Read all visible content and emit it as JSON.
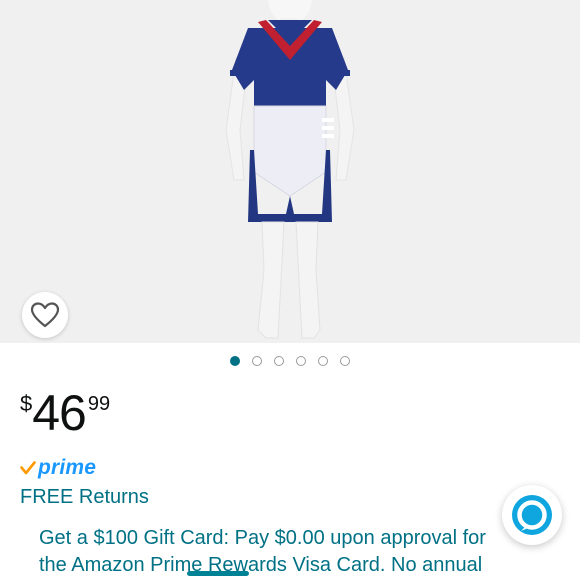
{
  "product": {
    "image_alt": "Child mannequin wearing navy sailor costume with white apron",
    "carousel": {
      "total": 6,
      "active_index": 0
    }
  },
  "price": {
    "symbol": "$",
    "whole": "46",
    "fraction": "99"
  },
  "prime": {
    "check": "✓",
    "label": "prime"
  },
  "returns_label": "FREE Returns",
  "promo_text": "Get a $100 Gift Card: Pay $0.00 upon approval for the Amazon Prime Rewards Visa Card. No annual",
  "icons": {
    "wishlist": "heart-icon",
    "assistant": "alexa-icon"
  },
  "colors": {
    "link": "#007185",
    "prime_blue": "#1a98ff",
    "prime_check": "#ff9900",
    "text": "#0f1111",
    "image_bg": "#f0f0f0"
  }
}
